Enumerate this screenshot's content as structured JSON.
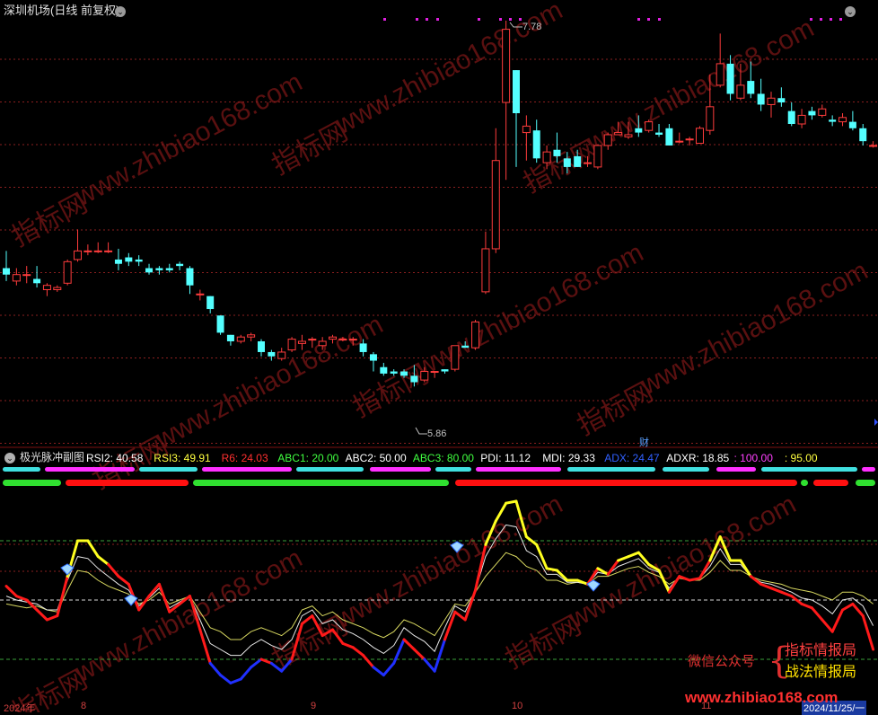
{
  "header": {
    "title": "深圳机场(日线 前复权)",
    "high_label": "7.78",
    "low_label": "5.86",
    "finance_marker": "财"
  },
  "indicator": {
    "name": "极光脉冲副图",
    "values": [
      {
        "text": "RSI2: 40.58",
        "color": "#ffffff"
      },
      {
        "text": "RSI3: 49.91",
        "color": "#ffff40"
      },
      {
        "text": "R6: 24.03",
        "color": "#ff3030"
      },
      {
        "text": "ABC1: 20.00",
        "color": "#40ff40"
      },
      {
        "text": "ABC2: 50.00",
        "color": "#ffffff"
      },
      {
        "text": "ABC3: 80.00",
        "color": "#40ff40"
      },
      {
        "text": "PDI: 11.12",
        "color": "#ffffff"
      },
      {
        "text": "MDI: 29.33",
        "color": "#ffffff"
      },
      {
        "text": "ADX: 24.47",
        "color": "#3060ff"
      },
      {
        "text": "ADXR: 18.85",
        "color": "#ffffff"
      },
      {
        "text": ": 100.00",
        "color": "#ff40ff"
      },
      {
        "text": ": 95.00",
        "color": "#ffff40"
      }
    ]
  },
  "date_axis": {
    "labels": [
      "2024年",
      "8",
      "9",
      "10",
      "11",
      "2024/11/25/一"
    ]
  },
  "watermark": {
    "wechat": "微信公众号",
    "brand1": "指标情报局",
    "brand2": "战法情报局",
    "url": "www.zhibiao168.com",
    "tiles": [
      "www.zhibiao168.com",
      "指标网"
    ]
  },
  "colors": {
    "up": "#ff3c3c",
    "down": "#54ffff",
    "grid": "#8a1f1f",
    "dash_green": "#3aa03a",
    "dash_white": "#d8d8d8"
  },
  "chart_data": {
    "type": "candlestick",
    "price_range": [
      5.86,
      7.78
    ],
    "candles": [
      [
        6.63,
        6.6,
        6.71,
        6.57
      ],
      [
        6.57,
        6.6,
        6.63,
        6.55
      ],
      [
        6.6,
        6.6,
        6.64,
        6.56
      ],
      [
        6.58,
        6.56,
        6.64,
        6.54
      ],
      [
        6.53,
        6.55,
        6.56,
        6.5
      ],
      [
        6.53,
        6.54,
        6.55,
        6.52
      ],
      [
        6.56,
        6.66,
        6.67,
        6.55
      ],
      [
        6.67,
        6.71,
        6.81,
        6.66
      ],
      [
        6.71,
        6.71,
        6.74,
        6.69
      ],
      [
        6.71,
        6.71,
        6.75,
        6.7
      ],
      [
        6.71,
        6.71,
        6.75,
        6.7
      ],
      [
        6.67,
        6.65,
        6.72,
        6.62
      ],
      [
        6.68,
        6.66,
        6.7,
        6.64
      ],
      [
        6.67,
        6.66,
        6.69,
        6.64
      ],
      [
        6.63,
        6.61,
        6.65,
        6.6
      ],
      [
        6.63,
        6.62,
        6.64,
        6.6
      ],
      [
        6.63,
        6.62,
        6.65,
        6.61
      ],
      [
        6.65,
        6.64,
        6.66,
        6.62
      ],
      [
        6.63,
        6.55,
        6.64,
        6.51
      ],
      [
        6.51,
        6.51,
        6.53,
        6.48
      ],
      [
        6.5,
        6.44,
        6.5,
        6.42
      ],
      [
        6.41,
        6.33,
        6.41,
        6.32
      ],
      [
        6.32,
        6.29,
        6.32,
        6.27
      ],
      [
        6.29,
        6.31,
        6.32,
        6.28
      ],
      [
        6.31,
        6.32,
        6.33,
        6.29
      ],
      [
        6.29,
        6.24,
        6.3,
        6.22
      ],
      [
        6.24,
        6.22,
        6.25,
        6.2
      ],
      [
        6.21,
        6.24,
        6.26,
        6.2
      ],
      [
        6.25,
        6.3,
        6.31,
        6.24
      ],
      [
        6.28,
        6.29,
        6.32,
        6.25
      ],
      [
        6.3,
        6.3,
        6.31,
        6.26
      ],
      [
        6.27,
        6.29,
        6.31,
        6.25
      ],
      [
        6.3,
        6.31,
        6.32,
        6.28
      ],
      [
        6.3,
        6.3,
        6.31,
        6.29
      ],
      [
        6.3,
        6.3,
        6.31,
        6.27
      ],
      [
        6.28,
        6.24,
        6.3,
        6.22
      ],
      [
        6.23,
        6.2,
        6.24,
        6.15
      ],
      [
        6.17,
        6.14,
        6.19,
        6.13
      ],
      [
        6.15,
        6.14,
        6.16,
        6.13
      ],
      [
        6.15,
        6.13,
        6.16,
        6.12
      ],
      [
        6.13,
        6.1,
        6.18,
        6.08
      ],
      [
        6.11,
        6.15,
        6.17,
        6.1
      ],
      [
        6.15,
        6.15,
        6.15,
        6.12
      ],
      [
        6.16,
        6.15,
        6.16,
        6.14
      ],
      [
        6.16,
        6.27,
        6.27,
        6.15
      ],
      [
        6.27,
        6.26,
        6.29,
        6.26
      ],
      [
        6.26,
        6.38,
        6.39,
        6.25
      ],
      [
        6.52,
        6.72,
        6.8,
        6.51
      ],
      [
        6.72,
        7.13,
        7.28,
        6.7
      ],
      [
        7.4,
        7.74,
        7.78,
        7.04
      ],
      [
        7.55,
        7.35,
        7.55,
        7.1
      ],
      [
        7.26,
        7.29,
        7.34,
        7.13
      ],
      [
        7.27,
        7.14,
        7.32,
        7.12
      ],
      [
        7.12,
        7.17,
        7.2,
        7.09
      ],
      [
        7.18,
        7.15,
        7.26,
        7.12
      ],
      [
        7.14,
        7.1,
        7.17,
        7.07
      ],
      [
        7.15,
        7.1,
        7.18,
        7.1
      ],
      [
        7.12,
        7.12,
        7.15,
        7.1
      ],
      [
        7.1,
        7.2,
        7.2,
        7.09
      ],
      [
        7.2,
        7.25,
        7.26,
        7.18
      ],
      [
        7.25,
        7.26,
        7.31,
        7.25
      ],
      [
        7.24,
        7.25,
        7.31,
        7.23
      ],
      [
        7.28,
        7.26,
        7.34,
        7.24
      ],
      [
        7.27,
        7.31,
        7.32,
        7.26
      ],
      [
        7.26,
        7.25,
        7.3,
        7.24
      ],
      [
        7.28,
        7.2,
        7.3,
        7.2
      ],
      [
        7.22,
        7.22,
        7.26,
        7.21
      ],
      [
        7.23,
        7.23,
        7.24,
        7.2
      ],
      [
        7.21,
        7.28,
        7.29,
        7.21
      ],
      [
        7.27,
        7.38,
        7.53,
        7.25
      ],
      [
        7.48,
        7.58,
        7.72,
        7.47
      ],
      [
        7.58,
        7.44,
        7.62,
        7.41
      ],
      [
        7.42,
        7.48,
        7.58,
        7.41
      ],
      [
        7.5,
        7.44,
        7.59,
        7.42
      ],
      [
        7.44,
        7.39,
        7.51,
        7.36
      ],
      [
        7.39,
        7.42,
        7.45,
        7.33
      ],
      [
        7.42,
        7.4,
        7.47,
        7.38
      ],
      [
        7.36,
        7.3,
        7.4,
        7.29
      ],
      [
        7.3,
        7.34,
        7.37,
        7.28
      ],
      [
        7.36,
        7.34,
        7.38,
        7.32
      ],
      [
        7.34,
        7.37,
        7.39,
        7.33
      ],
      [
        7.32,
        7.31,
        7.34,
        7.29
      ],
      [
        7.31,
        7.33,
        7.35,
        7.29
      ],
      [
        7.31,
        7.28,
        7.36,
        7.27
      ],
      [
        7.28,
        7.22,
        7.3,
        7.2
      ],
      [
        7.2,
        7.2,
        7.22,
        7.19
      ]
    ]
  }
}
